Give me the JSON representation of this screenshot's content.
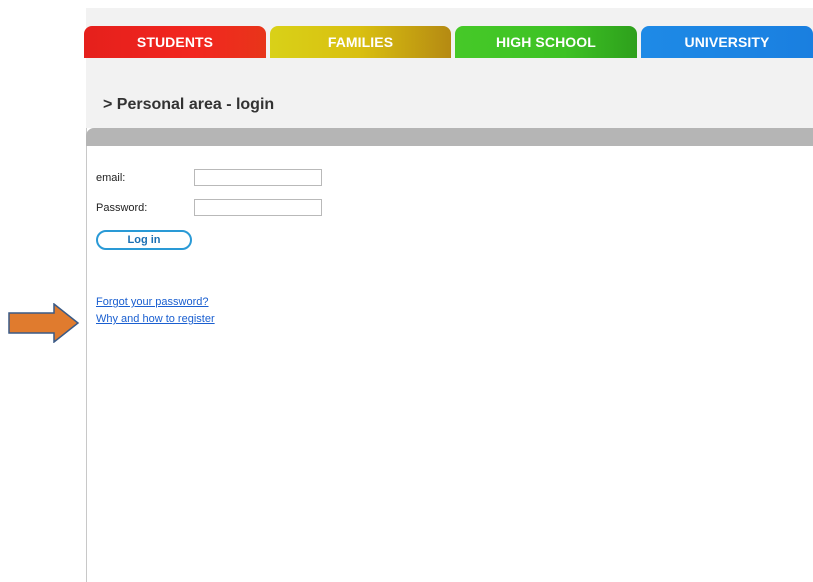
{
  "nav": {
    "tabs": [
      {
        "label": "STUDENTS",
        "color": "#f2261f"
      },
      {
        "label": "FAMILIES",
        "color": "#d9c414"
      },
      {
        "label": "HIGH SCHOOL",
        "color": "#3dc224"
      },
      {
        "label": "UNIVERSITY",
        "color": "#1a7fe0"
      }
    ]
  },
  "page": {
    "title": "> Personal area - login"
  },
  "login_form": {
    "email_label": "email:",
    "email_value": "",
    "password_label": "Password:",
    "password_value": "",
    "submit_label": "Log in"
  },
  "links": {
    "forgot_password": "Forgot your password?",
    "register_info": "Why and how to register"
  },
  "annotation": {
    "arrow_icon": "arrow-right-icon",
    "arrow_color": "#e07b2e"
  }
}
